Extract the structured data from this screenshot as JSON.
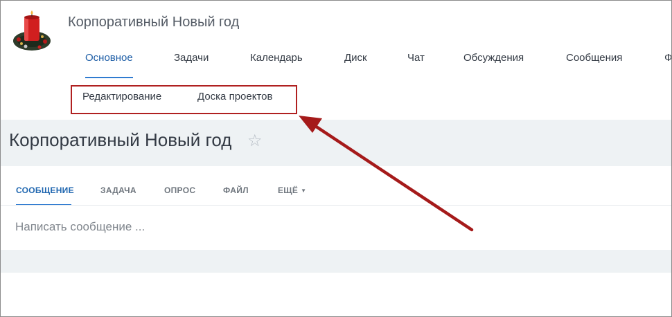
{
  "header": {
    "group_name": "Корпоративный Новый год",
    "logo_icon": "christmas-candle-wreath-icon"
  },
  "main_nav": {
    "items": [
      {
        "label": "Основное",
        "active": true
      },
      {
        "label": "Задачи"
      },
      {
        "label": "Календарь"
      },
      {
        "label": "Диск"
      },
      {
        "label": "Чат"
      },
      {
        "label": "Обсуждения"
      },
      {
        "label": "Сообщения"
      },
      {
        "label": "Ф"
      }
    ]
  },
  "sub_nav": {
    "items": [
      {
        "label": "Редактирование"
      },
      {
        "label": "Доска проектов"
      }
    ]
  },
  "page": {
    "title": "Корпоративный Новый год",
    "star_icon": "star-outline-icon"
  },
  "post_form": {
    "tabs": [
      {
        "label": "СООБЩЕНИЕ",
        "active": true
      },
      {
        "label": "ЗАДАЧА"
      },
      {
        "label": "ОПРОС"
      },
      {
        "label": "ФАЙЛ"
      },
      {
        "label": "ЕЩЁ"
      }
    ],
    "placeholder": "Написать сообщение ..."
  },
  "colors": {
    "accent": "#2f7bd0",
    "annotation": "#b02020",
    "band": "#eef2f4"
  }
}
